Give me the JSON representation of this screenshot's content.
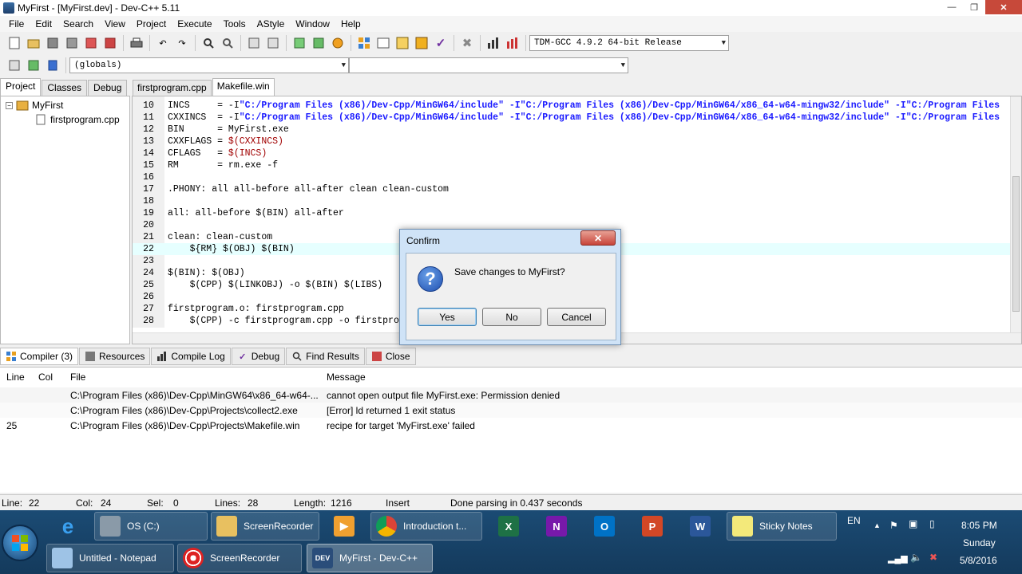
{
  "window": {
    "title": "MyFirst - [MyFirst.dev] - Dev-C++ 5.11",
    "controls": {
      "minimize": "—",
      "maximize": "❐",
      "close": "✕"
    }
  },
  "menu": [
    "File",
    "Edit",
    "Search",
    "View",
    "Project",
    "Execute",
    "Tools",
    "AStyle",
    "Window",
    "Help"
  ],
  "toolbar": {
    "compiler_select": "TDM-GCC 4.9.2 64-bit Release",
    "scope_select": "(globals)",
    "function_select": ""
  },
  "left_tabs": [
    "Project",
    "Classes",
    "Debug"
  ],
  "project_tree": {
    "root": "MyFirst",
    "file": "firstprogram.cpp"
  },
  "editor_tabs": [
    "firstprogram.cpp",
    "Makefile.win"
  ],
  "code_lines": [
    {
      "num": "10",
      "pre": "INCS     = -I",
      "str": "\"C:/Program Files (x86)/Dev-Cpp/MinGW64/include\" -I\"C:/Program Files (x86)/Dev-Cpp/MinGW64/x86_64-w64-mingw32/include\" -I\"C:/Program Files",
      "post": ""
    },
    {
      "num": "11",
      "pre": "CXXINCS  = -I",
      "str": "\"C:/Program Files (x86)/Dev-Cpp/MinGW64/include\" -I\"C:/Program Files (x86)/Dev-Cpp/MinGW64/x86_64-w64-mingw32/include\" -I\"C:/Program Files",
      "post": ""
    },
    {
      "num": "12",
      "pre": "BIN      = MyFirst.exe",
      "str": "",
      "post": ""
    },
    {
      "num": "13",
      "pre": "CXXFLAGS = ",
      "var": "$(CXXINCS)"
    },
    {
      "num": "14",
      "pre": "CFLAGS   = ",
      "var": "$(INCS)"
    },
    {
      "num": "15",
      "pre": "RM       = rm.exe -f"
    },
    {
      "num": "16",
      "pre": ""
    },
    {
      "num": "17",
      "pre": ".PHONY: all all-before all-after clean clean-custom"
    },
    {
      "num": "18",
      "pre": ""
    },
    {
      "num": "19",
      "pre": "all: all-before $(BIN) all-after"
    },
    {
      "num": "20",
      "pre": ""
    },
    {
      "num": "21",
      "pre": "clean: clean-custom"
    },
    {
      "num": "22",
      "pre": "    ${RM} $(OBJ) $(BIN)"
    },
    {
      "num": "23",
      "pre": ""
    },
    {
      "num": "24",
      "pre": "$(BIN): $(OBJ)"
    },
    {
      "num": "25",
      "pre": "    $(CPP) $(LINKOBJ) -o $(BIN) $(LIBS)"
    },
    {
      "num": "26",
      "pre": ""
    },
    {
      "num": "27",
      "pre": "firstprogram.o: firstprogram.cpp"
    },
    {
      "num": "28",
      "pre": "    $(CPP) -c firstprogram.cpp -o firstprogram.o $(CXXFLAGS)"
    }
  ],
  "bottom_tabs": [
    "Compiler (3)",
    "Resources",
    "Compile Log",
    "Debug",
    "Find Results",
    "Close"
  ],
  "messages": {
    "headers": {
      "line": "Line",
      "col": "Col",
      "file": "File",
      "message": "Message"
    },
    "rows": [
      {
        "line": "",
        "col": "",
        "file": "C:\\Program Files (x86)\\Dev-Cpp\\MinGW64\\x86_64-w64-...",
        "message": "cannot open output file MyFirst.exe: Permission denied"
      },
      {
        "line": "",
        "col": "",
        "file": "C:\\Program Files (x86)\\Dev-Cpp\\Projects\\collect2.exe",
        "message": "[Error] ld returned 1 exit status"
      },
      {
        "line": "25",
        "col": "",
        "file": "C:\\Program Files (x86)\\Dev-Cpp\\Projects\\Makefile.win",
        "message": "recipe for target 'MyFirst.exe' failed"
      }
    ]
  },
  "status": {
    "line_label": "Line:",
    "line": "22",
    "col_label": "Col:",
    "col": "24",
    "sel_label": "Sel:",
    "sel": "0",
    "lines_label": "Lines:",
    "lines": "28",
    "length_label": "Length:",
    "length": "1216",
    "mode": "Insert",
    "parse": "Done parsing in 0.437 seconds"
  },
  "dialog": {
    "title": "Confirm",
    "message": "Save changes to MyFirst?",
    "yes": "Yes",
    "no": "No",
    "cancel": "Cancel",
    "close": "✕"
  },
  "taskbar": {
    "row1": [
      "OS (C:)",
      "ScreenRecorder",
      "Introduction t...",
      "Sticky Notes"
    ],
    "row2": [
      "Untitled - Notepad",
      "ScreenRecorder",
      "MyFirst - Dev-C++"
    ],
    "lang": "EN",
    "time": "8:05 PM",
    "day": "Sunday",
    "date": "5/8/2016",
    "icon_letters": {
      "excel": "X",
      "onenote": "N",
      "outlook": "O",
      "powerpoint": "P",
      "word": "W",
      "dev": "DEV"
    }
  }
}
